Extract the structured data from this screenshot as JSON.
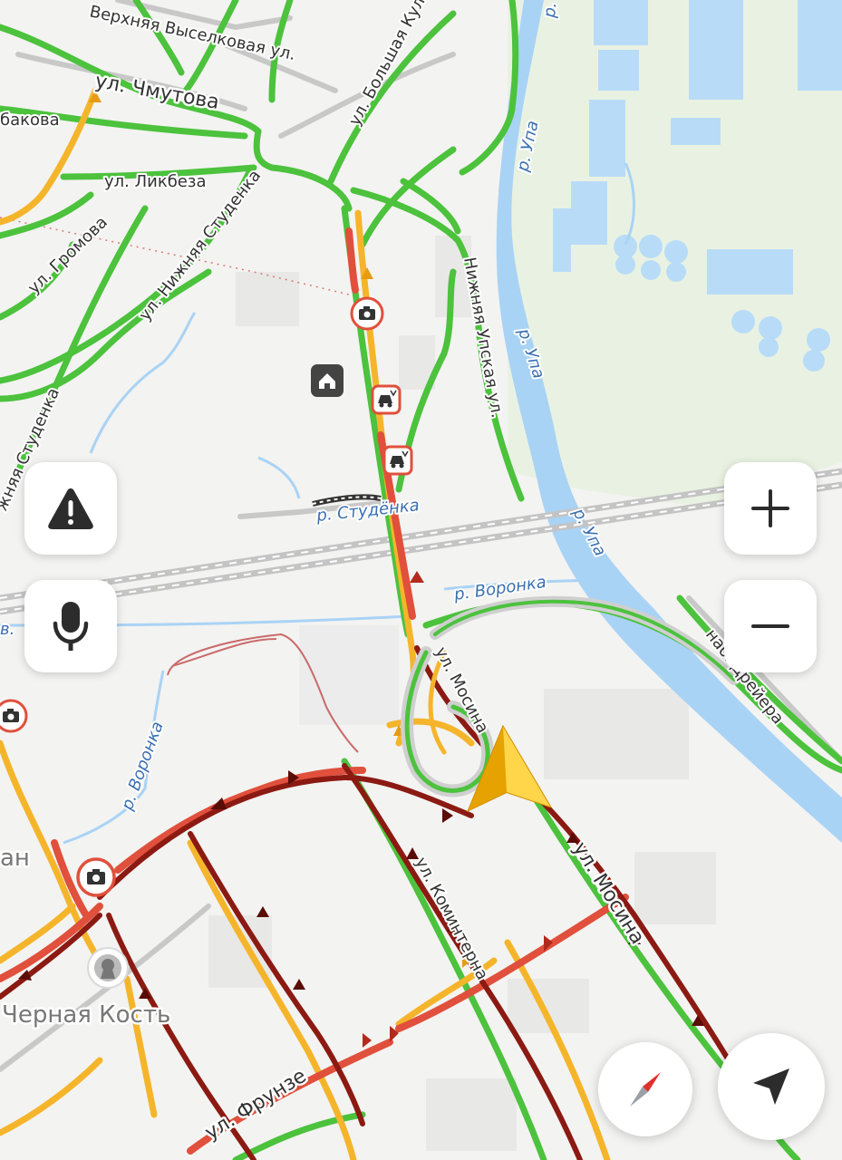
{
  "map": {
    "streets": {
      "verkhnyaya": "Верхняя Выселковая ул.",
      "chmutova": "ул. Чмутова",
      "bakova": "бакова",
      "likbeza": "ул. Ликбеза",
      "gromova": "ул. Громова",
      "nizhnyaya_studenka": "ул. Нижняя Студенка",
      "studenka_left": "жняя Студенка",
      "bolshaya_kuliga": "ул. Большая Кулига",
      "nizhneupskaya": "Нижняя Упская ул.",
      "mosina_upper": "ул. Мосина",
      "mosina_lower": "ул. Мосина",
      "kominterna": "ул. Коминтерна",
      "frunze": "ул. Фрунзе",
      "dreyera": "наб. Дрейера",
      "left_cut_an": "ан",
      "left_cut_v": "в."
    },
    "rivers": {
      "upa_1": "р. Упа",
      "upa_2": "р. Упа",
      "upa_3": "р. Упа",
      "studenka": "р. Студёнка",
      "voronka_1": "р. Воронка",
      "voronka_2": "р. Воронка"
    },
    "poi": {
      "chernaya_kost": "Черная Кость"
    },
    "traffic_colors": {
      "free": "#4cc23d",
      "slow": "#f5b52b",
      "jam": "#e0503c",
      "heavy": "#8b1a12"
    },
    "water_color": "#a9d3f5",
    "markers": [
      "camera-icon",
      "accident-icon",
      "home-icon",
      "user-location-arrow-icon"
    ]
  },
  "controls": {
    "report_icon": "warning-icon",
    "voice_icon": "microphone-icon",
    "zoom_in_icon": "plus-icon",
    "zoom_out_icon": "minus-icon",
    "compass_icon": "compass-icon",
    "locate_icon": "navigation-arrow-icon"
  }
}
